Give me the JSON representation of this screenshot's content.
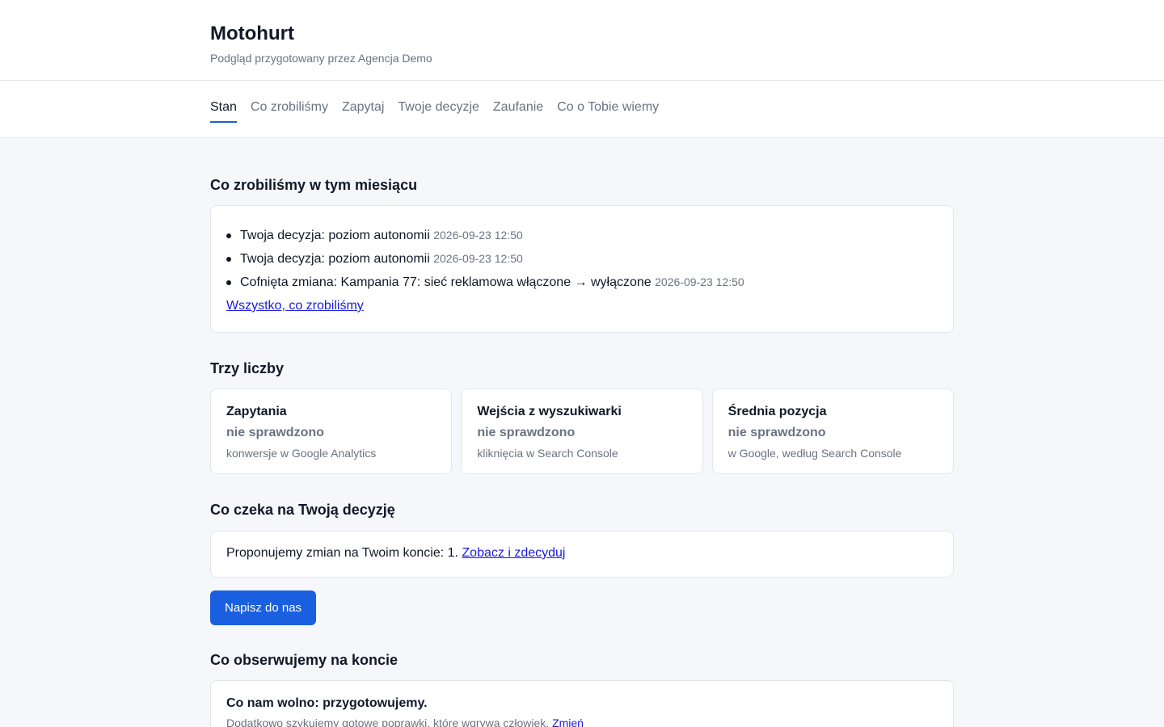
{
  "header": {
    "brand": "Motohurt",
    "subtitle": "Podgląd przygotowany przez Agencja Demo"
  },
  "nav": {
    "tabs": [
      {
        "label": "Stan",
        "active": true
      },
      {
        "label": "Co zrobiliśmy",
        "active": false
      },
      {
        "label": "Zapytaj",
        "active": false
      },
      {
        "label": "Twoje decyzje",
        "active": false
      },
      {
        "label": "Zaufanie",
        "active": false
      },
      {
        "label": "Co o Tobie wiemy",
        "active": false
      }
    ]
  },
  "activity": {
    "title": "Co zrobiliśmy w tym miesiącu",
    "items": [
      {
        "text": "Twoja decyzja: poziom autonomii",
        "time": "2026-09-23 12:50"
      },
      {
        "text": "Twoja decyzja: poziom autonomii",
        "time": "2026-09-23 12:50"
      },
      {
        "text": "Cofnięta zmiana: Kampania 77: sieć reklamowa włączone → wyłączone",
        "time": "2026-09-23 12:50"
      }
    ],
    "all_link": "Wszystko, co zrobiliśmy"
  },
  "metrics": {
    "title": "Trzy liczby",
    "items": [
      {
        "title": "Zapytania",
        "value": "nie sprawdzono",
        "desc": "konwersje w Google Analytics"
      },
      {
        "title": "Wejścia z wyszukiwarki",
        "value": "nie sprawdzono",
        "desc": "kliknięcia w Search Console"
      },
      {
        "title": "Średnia pozycja",
        "value": "nie sprawdzono",
        "desc": "w Google, według Search Console"
      }
    ]
  },
  "decision": {
    "title": "Co czeka na Twoją decyzję",
    "text": "Proponujemy zmian na Twoim koncie: 1.",
    "link": "Zobacz i zdecyduj",
    "button": "Napisz do nas"
  },
  "observe": {
    "title": "Co obserwujemy na koncie",
    "card_title": "Co nam wolno: przygotowujemy.",
    "card_desc": "Dodatkowo szykujemy gotowe poprawki, które wgrywa człowiek.",
    "card_link": "Zmień"
  },
  "colors": {
    "accent": "#1a5fe0",
    "link": "#1a1ae0",
    "muted": "#6b7280",
    "background": "#f5f7fa"
  }
}
